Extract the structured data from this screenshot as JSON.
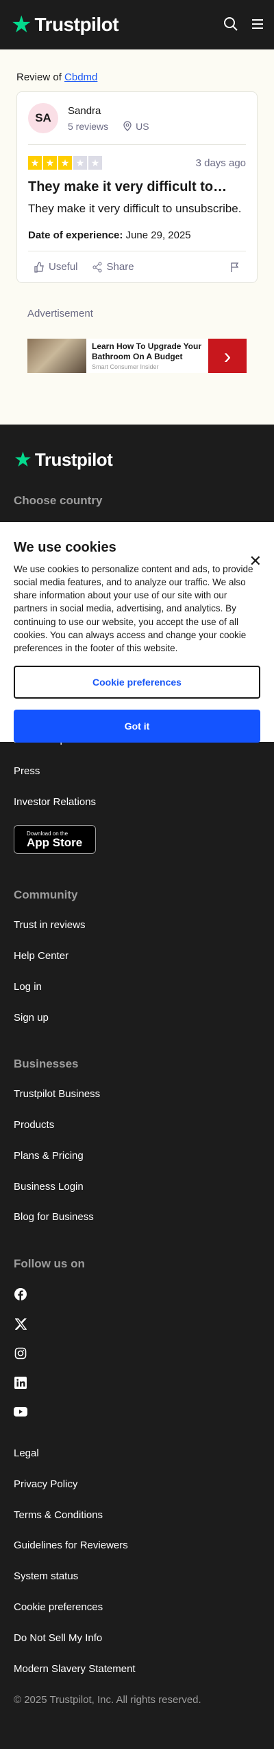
{
  "header": {
    "brand": "Trustpilot"
  },
  "review": {
    "prefix": "Review of ",
    "company": "Cbdmd",
    "avatar_initials": "SA",
    "user_name": "Sandra",
    "user_reviews": "5 reviews",
    "user_country": "US",
    "rating": 3,
    "max_rating": 5,
    "date_ago": "3 days ago",
    "title": "They make it very difficult to…",
    "body": "They make it very difficult to unsubscribe.",
    "experience_label": "Date of experience:",
    "experience_date": "June 29, 2025",
    "useful_label": "Useful",
    "share_label": "Share"
  },
  "ad": {
    "label": "Advertisement",
    "title": "Learn How To Upgrade Your Bathroom On A Budget",
    "source": "Smart Consumer Insider"
  },
  "footer": {
    "brand": "Trustpilot",
    "choose_country": "Choose country",
    "about_items": [
      "How Trustpilot works",
      "Press",
      "Investor Relations"
    ],
    "appstore_small": "Download on the",
    "appstore_big": "App Store",
    "community_heading": "Community",
    "community_items": [
      "Trust in reviews",
      "Help Center",
      "Log in",
      "Sign up"
    ],
    "business_heading": "Businesses",
    "business_items": [
      "Trustpilot Business",
      "Products",
      "Plans & Pricing",
      "Business Login",
      "Blog for Business"
    ],
    "follow_heading": "Follow us on",
    "social_icons": [
      "facebook-icon",
      "x-icon",
      "instagram-icon",
      "linkedin-icon",
      "youtube-icon"
    ],
    "legal_items": [
      "Legal",
      "Privacy Policy",
      "Terms & Conditions",
      "Guidelines for Reviewers",
      "System status",
      "Cookie preferences",
      "Do Not Sell My Info",
      "Modern Slavery Statement"
    ],
    "copyright": "© 2025 Trustpilot, Inc. All rights reserved."
  },
  "cookie": {
    "title": "We use cookies",
    "text": "We use cookies to personalize content and ads, to provide social media features, and to analyze our traffic. We also share information about your use of our site with our partners in social media, advertising, and analytics. By continuing to use our website, you accept the use of all cookies. You can always access and change your cookie preferences in the footer of this website.",
    "preferences_label": "Cookie preferences",
    "accept_label": "Got it"
  },
  "colors": {
    "brand_green": "#04da8d",
    "star_yellow": "#ffce00",
    "accent_blue": "#1454ff",
    "ad_red": "#c8171d"
  }
}
